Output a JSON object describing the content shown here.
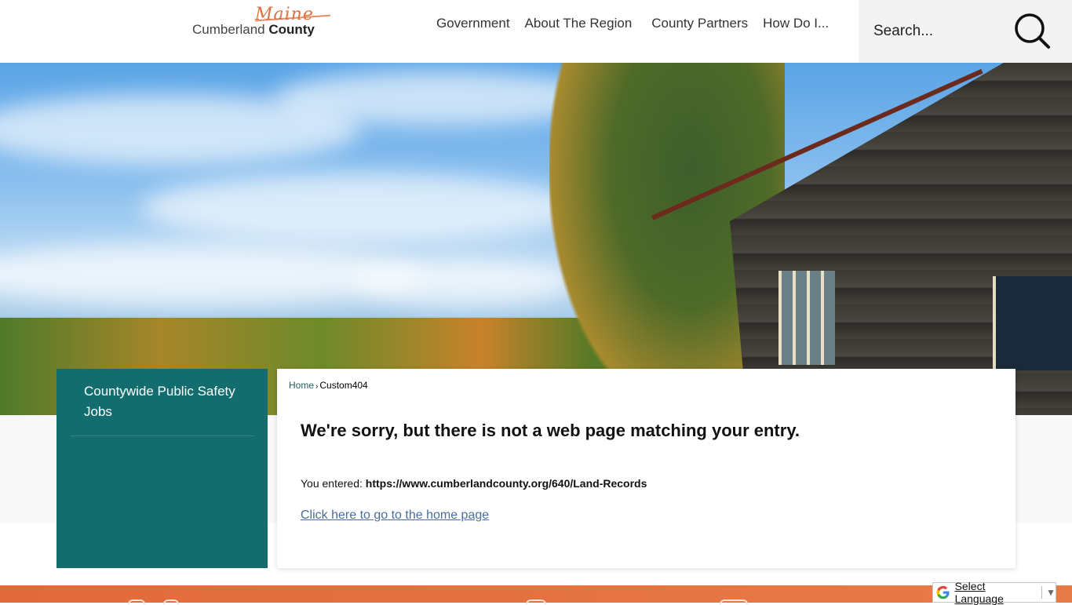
{
  "header": {
    "logo": {
      "script_word": "Maine",
      "name_light": "Cumberland",
      "name_bold": "County"
    },
    "nav": [
      "Government",
      "About The Region",
      "County Partners",
      "How Do I..."
    ],
    "search": {
      "placeholder": "Search...",
      "value": ""
    }
  },
  "sidebar": {
    "items": [
      {
        "label": "Countywide Public Safety Jobs"
      }
    ]
  },
  "content": {
    "breadcrumb": [
      {
        "label": "Home"
      },
      {
        "label": "Custom404"
      }
    ],
    "breadcrumb_separator": "›",
    "title": "We're sorry, but there is not a web page matching your entry.",
    "entered_label": "You entered:",
    "entered_url": "https://www.cumberlandcounty.org/640/Land-Records",
    "home_link": "Click here to go to the home page"
  },
  "translate": {
    "label": "Select Language",
    "arrow": "▼"
  },
  "colors": {
    "brand_teal": "#136d6f",
    "accent_orange": "#e26a3a",
    "link_blue": "#4a6e9b"
  }
}
